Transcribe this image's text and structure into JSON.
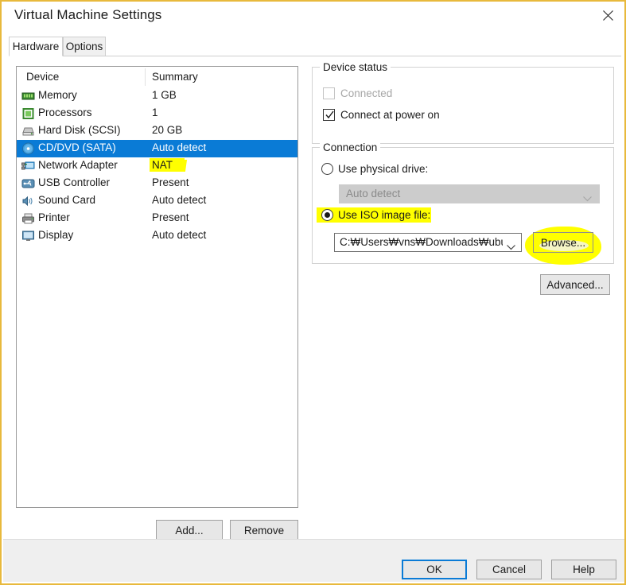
{
  "window": {
    "title": "Virtual Machine Settings",
    "close_icon": "close-icon",
    "border_color": "#e8b93c"
  },
  "tabs": [
    {
      "label": "Hardware",
      "active": true
    },
    {
      "label": "Options",
      "active": false
    }
  ],
  "device_list": {
    "headers": {
      "device": "Device",
      "summary": "Summary"
    },
    "rows": [
      {
        "icon": "memory-icon",
        "name": "Memory",
        "summary": "1 GB",
        "selected": false,
        "highlight": false
      },
      {
        "icon": "processor-icon",
        "name": "Processors",
        "summary": "1",
        "selected": false,
        "highlight": false
      },
      {
        "icon": "hard-disk-icon",
        "name": "Hard Disk (SCSI)",
        "summary": "20 GB",
        "selected": false,
        "highlight": false
      },
      {
        "icon": "cd-dvd-icon",
        "name": "CD/DVD (SATA)",
        "summary": "Auto detect",
        "selected": true,
        "highlight": false
      },
      {
        "icon": "network-adapter-icon",
        "name": "Network Adapter",
        "summary": "NAT",
        "selected": false,
        "highlight": true
      },
      {
        "icon": "usb-controller-icon",
        "name": "USB Controller",
        "summary": "Present",
        "selected": false,
        "highlight": false
      },
      {
        "icon": "sound-card-icon",
        "name": "Sound Card",
        "summary": "Auto detect",
        "selected": false,
        "highlight": false
      },
      {
        "icon": "printer-icon",
        "name": "Printer",
        "summary": "Present",
        "selected": false,
        "highlight": false
      },
      {
        "icon": "display-icon",
        "name": "Display",
        "summary": "Auto detect",
        "selected": false,
        "highlight": false
      }
    ],
    "selection_color": "#0a7bd6"
  },
  "list_buttons": {
    "add": "Add...",
    "remove": "Remove"
  },
  "device_status": {
    "legend": "Device status",
    "connected": {
      "label": "Connected",
      "checked": false,
      "disabled": true
    },
    "connect_at_power_on": {
      "label": "Connect at power on",
      "checked": true,
      "disabled": false
    }
  },
  "connection": {
    "legend": "Connection",
    "use_physical_drive": {
      "label": "Use physical drive:",
      "selected": false
    },
    "physical_drive_value": "Auto detect",
    "use_iso_image_file": {
      "label": "Use ISO image file:",
      "selected": true,
      "highlighted": true
    },
    "iso_path_value": "C:₩Users₩vns₩Downloads₩ubun",
    "browse_label": "Browse...",
    "browse_highlighted": true,
    "advanced_label": "Advanced..."
  },
  "footer": {
    "ok": "OK",
    "cancel": "Cancel",
    "help": "Help",
    "default_button": "OK",
    "focus_color": "#0a7bd6"
  },
  "annotation": {
    "marker_color": "#ffff00"
  }
}
